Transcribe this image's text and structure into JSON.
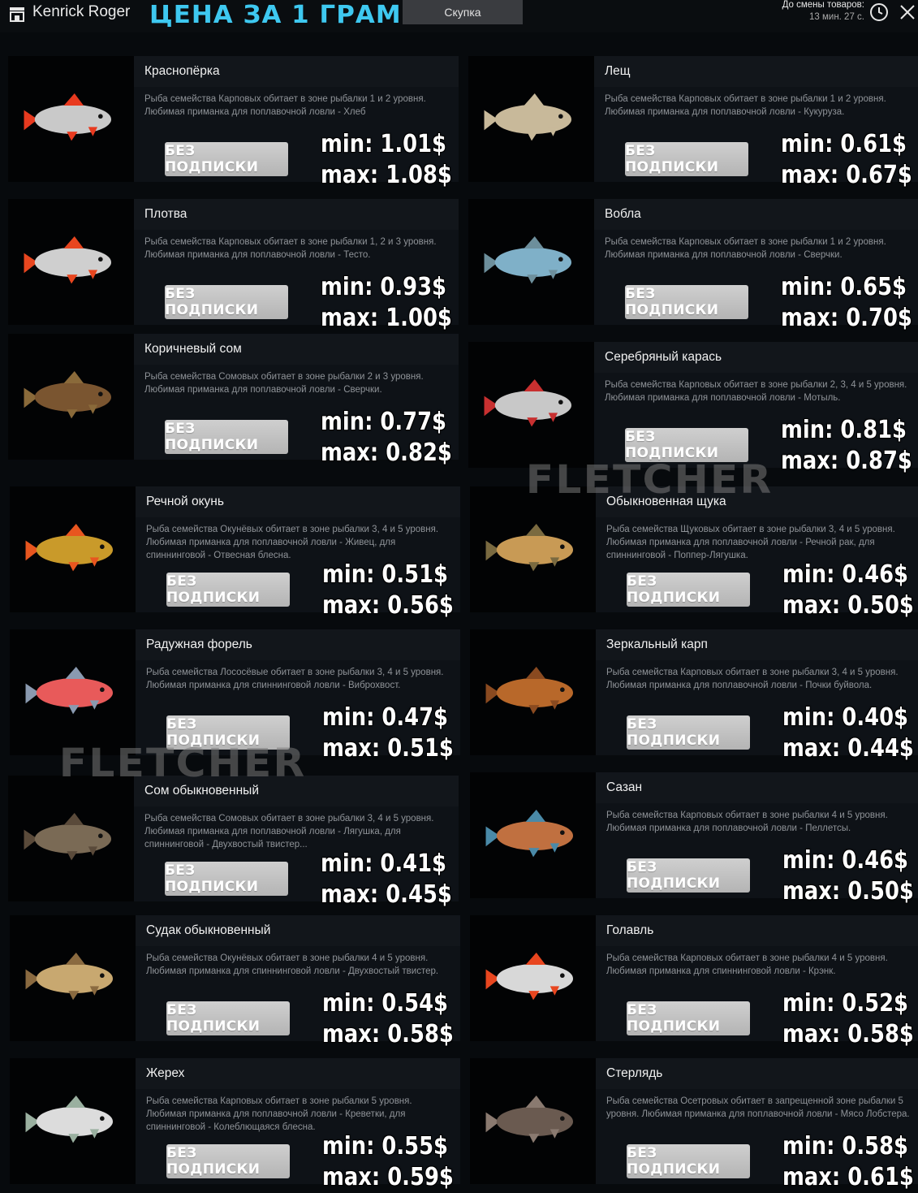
{
  "header": {
    "username": "Kenrick Roger",
    "heading": "ЦЕНА ЗА 1 ГРАММ",
    "tab_label": "Скупка",
    "timer_label": "До смены товаров:",
    "timer_value": "13 мин. 27 с."
  },
  "watermark": "FLETCHER",
  "colors": {
    "heading": "#3ec8f0",
    "card_bg": "#0e1217",
    "button_bg": "#c4c4c4"
  },
  "fish": [
    {
      "name": "Краснопёрка",
      "desc": "Рыба семейства Карповых обитает в зоне рыбалки 1 и 2 уровня. Любимая приманка для поплавочной ловли - Хлеб",
      "button": "БЕЗ ПОДПИСКИ",
      "min": "min: 1.01$",
      "max": "max: 1.08$",
      "icon": "rudd-fish-icon"
    },
    {
      "name": "Лещ",
      "desc": "Рыба семейства Карповых обитает в зоне рыбалки 1 и 2 уровня. Любимая приманка для поплавочной ловли - Кукуруза.",
      "button": "БЕЗ ПОДПИСКИ",
      "min": "min: 0.61$",
      "max": "max: 0.67$",
      "icon": "bream-fish-icon"
    },
    {
      "name": "Плотва",
      "desc": "Рыба семейства Карповых обитает в зоне рыбалки 1, 2 и 3 уровня. Любимая приманка для поплавочной ловли - Тесто.",
      "button": "БЕЗ ПОДПИСКИ",
      "min": "min: 0.93$",
      "max": "max: 1.00$",
      "icon": "roach-fish-icon"
    },
    {
      "name": "Вобла",
      "desc": "Рыба семейства Карповых обитает в зоне рыбалки 1 и 2 уровня. Любимая приманка для поплавочной ловли - Сверчки.",
      "button": "БЕЗ ПОДПИСКИ",
      "min": "min: 0.65$",
      "max": "max: 0.70$",
      "icon": "vobla-fish-icon"
    },
    {
      "name": "Коричневый сом",
      "desc": "Рыба семейства Сомовых обитает в зоне рыбалки 2 и 3 уровня. Любимая приманка для поплавочной ловли - Сверчки.",
      "button": "БЕЗ ПОДПИСКИ",
      "min": "min: 0.77$",
      "max": "max: 0.82$",
      "icon": "brown-catfish-icon"
    },
    {
      "name": "Серебряный карась",
      "desc": "Рыба семейства Карповых обитает в зоне рыбалки 2, 3, 4 и 5 уровня. Любимая приманка для поплавочной ловли - Мотыль.",
      "button": "БЕЗ ПОДПИСКИ",
      "min": "min: 0.81$",
      "max": "max: 0.87$",
      "icon": "silver-carp-icon"
    },
    {
      "name": "Речной окунь",
      "desc": "Рыба семейства Окунёвых обитает в зоне рыбалки 3, 4 и 5 уровня. Любимая приманка для поплавочной ловли - Живец, для спиннинговой - Отвесная блесна.",
      "button": "БЕЗ ПОДПИСКИ",
      "min": "min: 0.51$",
      "max": "max: 0.56$",
      "icon": "perch-fish-icon"
    },
    {
      "name": "Обыкновенная щука",
      "desc": "Рыба семейства Щуковых обитает в зоне рыбалки 3, 4 и 5 уровня. Любимая приманка для поплавочной ловли - Речной рак, для спиннинговой - Поппер-Лягушка.",
      "button": "БЕЗ ПОДПИСКИ",
      "min": "min: 0.46$",
      "max": "max: 0.50$",
      "icon": "pike-fish-icon"
    },
    {
      "name": "Радужная форель",
      "desc": "Рыба семейства Лососёвые обитает в зоне рыбалки 3, 4 и 5 уровня. Любимая приманка для спиннинговой ловли - Виброхвост.",
      "button": "БЕЗ ПОДПИСКИ",
      "min": "min: 0.47$",
      "max": "max: 0.51$",
      "icon": "trout-fish-icon"
    },
    {
      "name": "Зеркальный карп",
      "desc": "Рыба семейства Карповых обитает в зоне рыбалки 3, 4 и 5 уровня. Любимая приманка для поплавочной ловли - Почки буйвола.",
      "button": "БЕЗ ПОДПИСКИ",
      "min": "min: 0.40$",
      "max": "max: 0.44$",
      "icon": "mirror-carp-icon"
    },
    {
      "name": "Сом обыкновенный",
      "desc": "Рыба семейства Сомовых обитает в зоне рыбалки 3, 4 и 5 уровня. Любимая приманка для поплавочной ловли - Лягушка, для спиннинговой - Двухвостый твистер...",
      "button": "БЕЗ ПОДПИСКИ",
      "min": "min: 0.41$",
      "max": "max: 0.45$",
      "icon": "catfish-icon"
    },
    {
      "name": "Сазан",
      "desc": "Рыба семейства Карповых обитает в зоне рыбалки 4 и 5 уровня. Любимая приманка для поплавочной ловли - Пеллетсы.",
      "button": "БЕЗ ПОДПИСКИ",
      "min": "min: 0.46$",
      "max": "max: 0.50$",
      "icon": "wild-carp-icon"
    },
    {
      "name": "Судак обыкновенный",
      "desc": "Рыба семейства Окунёвых обитает в зоне рыбалки 4 и 5 уровня. Любимая приманка для спиннинговой ловли - Двухвостый твистер.",
      "button": "БЕЗ ПОДПИСКИ",
      "min": "min: 0.54$",
      "max": "max: 0.58$",
      "icon": "zander-fish-icon"
    },
    {
      "name": "Голавль",
      "desc": "Рыба семейства Карповых обитает в зоне рыбалки 4 и 5 уровня. Любимая приманка для спиннинговой ловли - Крэнк.",
      "button": "БЕЗ ПОДПИСКИ",
      "min": "min: 0.52$",
      "max": "max: 0.58$",
      "icon": "chub-fish-icon"
    },
    {
      "name": "Жерех",
      "desc": "Рыба семейства Карповых обитает в зоне рыбалки 5 уровня. Любимая приманка для поплавочной ловли - Креветки, для спиннинговой - Колеблющаяся блесна.",
      "button": "БЕЗ ПОДПИСКИ",
      "min": "min: 0.55$",
      "max": "max: 0.59$",
      "icon": "asp-fish-icon"
    },
    {
      "name": "Стерлядь",
      "desc": "Рыба семейства Осетровых обитает в запрещенной зоне рыбалки 5 уровня. Любимая приманка для поплавочной ловли - Мясо Лобстера.",
      "button": "БЕЗ ПОДПИСКИ",
      "min": "min: 0.58$",
      "max": "max: 0.61$",
      "icon": "sterlet-fish-icon"
    }
  ]
}
